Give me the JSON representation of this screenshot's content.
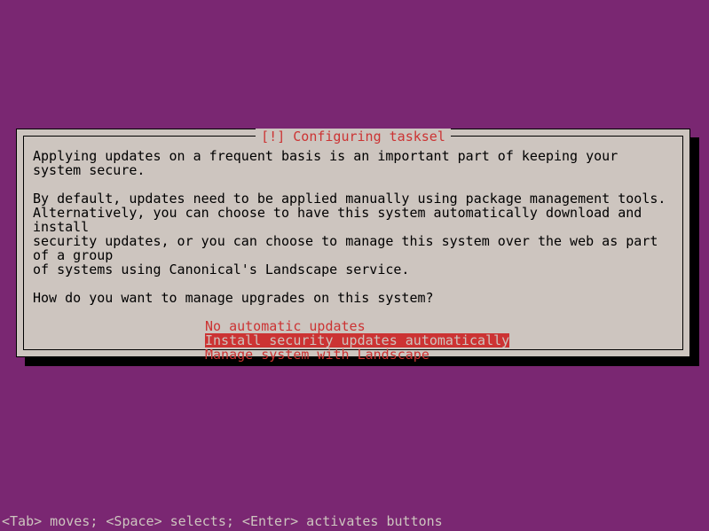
{
  "dialog": {
    "title": "[!] Configuring tasksel",
    "paragraph1": "Applying updates on a frequent basis is an important part of keeping your system secure.",
    "paragraph2": "By default, updates need to be applied manually using package management tools.\nAlternatively, you can choose to have this system automatically download and install\nsecurity updates, or you can choose to manage this system over the web as part of a group\nof systems using Canonical's Landscape service.",
    "question": "How do you want to manage upgrades on this system?",
    "options": [
      {
        "label": "No automatic updates",
        "selected": false
      },
      {
        "label": "Install security updates automatically",
        "selected": true
      },
      {
        "label": "Manage system with Landscape",
        "selected": false
      }
    ]
  },
  "footer": {
    "hints": "<Tab> moves; <Space> selects; <Enter> activates buttons"
  }
}
